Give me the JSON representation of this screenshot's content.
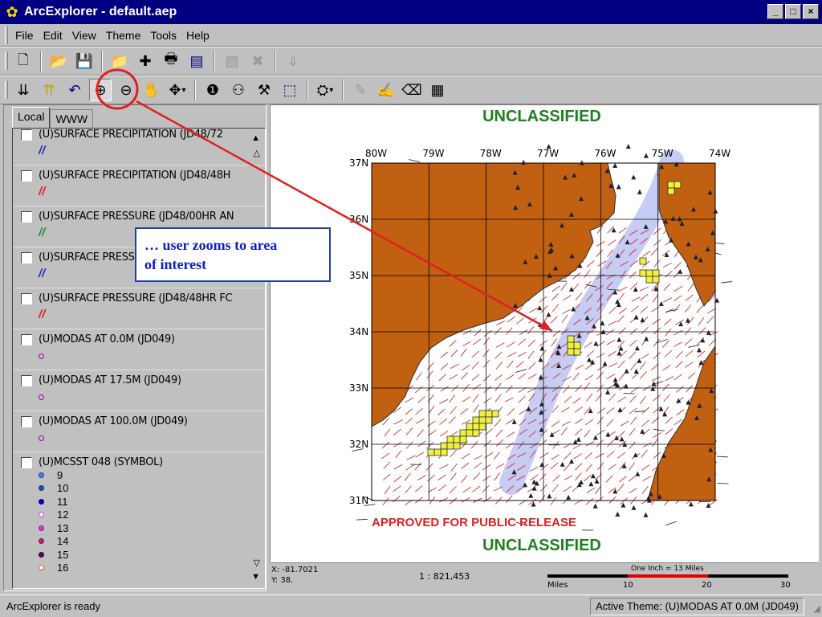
{
  "window": {
    "title": "ArcExplorer - default.aep",
    "minimize": "_",
    "maximize": "□",
    "close": "×"
  },
  "menu": [
    {
      "label": "File"
    },
    {
      "label": "Edit"
    },
    {
      "label": "View"
    },
    {
      "label": "Theme"
    },
    {
      "label": "Tools"
    },
    {
      "label": "Help"
    }
  ],
  "toolbar1": [
    {
      "name": "new-icon",
      "glyph": "🗋"
    },
    {
      "name": "open-folder-icon",
      "glyph": "📂"
    },
    {
      "name": "save-icon",
      "glyph": "💾"
    },
    {
      "name": "open-project-icon",
      "glyph": "📁"
    },
    {
      "name": "add-theme-icon",
      "glyph": "✚"
    },
    {
      "name": "print-icon",
      "glyph": "🖶"
    },
    {
      "name": "properties-icon",
      "glyph": "▤"
    },
    {
      "name": "image-icon",
      "glyph": "🖼"
    },
    {
      "name": "delete-icon",
      "glyph": "✖"
    },
    {
      "name": "export-icon",
      "glyph": "⇓"
    }
  ],
  "toolbar2": [
    {
      "name": "zoom-full-icon",
      "glyph": "⇊"
    },
    {
      "name": "zoom-active-icon",
      "glyph": "⇈"
    },
    {
      "name": "undo-zoom-icon",
      "glyph": "↶"
    },
    {
      "name": "zoom-in-icon",
      "glyph": "🔍"
    },
    {
      "name": "zoom-out-icon",
      "glyph": "🔎"
    },
    {
      "name": "pan-icon",
      "glyph": "✋"
    },
    {
      "name": "move-icon",
      "glyph": "✥"
    },
    {
      "name": "identify-icon",
      "glyph": "❶"
    },
    {
      "name": "find-icon",
      "glyph": "🔭"
    },
    {
      "name": "measure-icon",
      "glyph": "⚒"
    },
    {
      "name": "select-icon",
      "glyph": "⬚"
    },
    {
      "name": "query-icon",
      "glyph": "⛭"
    },
    {
      "name": "hyperlink-icon",
      "glyph": "✎"
    },
    {
      "name": "label-icon",
      "glyph": "✍"
    },
    {
      "name": "eraser-icon",
      "glyph": "⌫"
    },
    {
      "name": "theme-properties-icon",
      "glyph": "▦"
    }
  ],
  "tabs": {
    "local": "Local",
    "www": "WWW"
  },
  "themes": [
    {
      "label": "(U)SURFACE PRECIPITATION (JD48/72",
      "symbol": "//",
      "color": "#2030c0"
    },
    {
      "label": "(U)SURFACE PRECIPITATION (JD48/48H",
      "symbol": "//",
      "color": "#e02020"
    },
    {
      "label": "(U)SURFACE PRESSURE (JD48/00HR AN",
      "symbol": "//",
      "color": "#209040"
    },
    {
      "label": "(U)SURFACE PRESSURE (JD48/24HR AN",
      "symbol": "//",
      "color": "#2030c0"
    },
    {
      "label": "(U)SURFACE PRESSURE (JD48/48HR FC",
      "symbol": "//",
      "color": "#e02020"
    },
    {
      "label": "(U)MODAS AT 0.0M (JD049)",
      "symbol": "o",
      "color": "#a000a0"
    },
    {
      "label": "(U)MODAS AT 17.5M (JD049)",
      "symbol": "o",
      "color": "#a000a0"
    },
    {
      "label": "(U)MODAS AT 100.0M (JD049)",
      "symbol": "o",
      "color": "#a000a0"
    }
  ],
  "sst": {
    "label": "(U)MCSST 048 (SYMBOL)",
    "items": [
      {
        "value": "9",
        "color": "#5080e0"
      },
      {
        "value": "10",
        "color": "#2050b0"
      },
      {
        "value": "11",
        "color": "#0000c0"
      },
      {
        "value": "12",
        "color": "#ffffff"
      },
      {
        "value": "13",
        "color": "#d040c0"
      },
      {
        "value": "14",
        "color": "#c02080"
      },
      {
        "value": "15",
        "color": "#600060"
      },
      {
        "value": "16",
        "color": "#ffffff"
      }
    ]
  },
  "map": {
    "banner_top": "UNCLASSIFIED",
    "banner_bottom": "UNCLASSIFIED",
    "release": "APPROVED FOR PUBLIC RELEASE",
    "lon_labels": [
      "80W",
      "79W",
      "78W",
      "77W",
      "76W",
      "75W",
      "74W"
    ],
    "lat_labels": [
      "37N",
      "36N",
      "35N",
      "34N",
      "33N",
      "32N",
      "31N"
    ],
    "land_color": "#c06010",
    "grid_color": "#000000",
    "banner_color": "#208020",
    "release_color": "#e02020"
  },
  "callout": {
    "line1": "… user zooms to area",
    "line2": "of interest"
  },
  "coord": {
    "x": "X: -81.7021",
    "y": "Y: 38.",
    "scale": "1 : 821,453",
    "scalebar_title": "One Inch = 13 Miles",
    "unit": "Miles",
    "ticks": [
      "10",
      "20",
      "30"
    ]
  },
  "status": {
    "text": "ArcExplorer is ready",
    "active_theme": "Active Theme: (U)MODAS AT 0.0M (JD049)"
  }
}
